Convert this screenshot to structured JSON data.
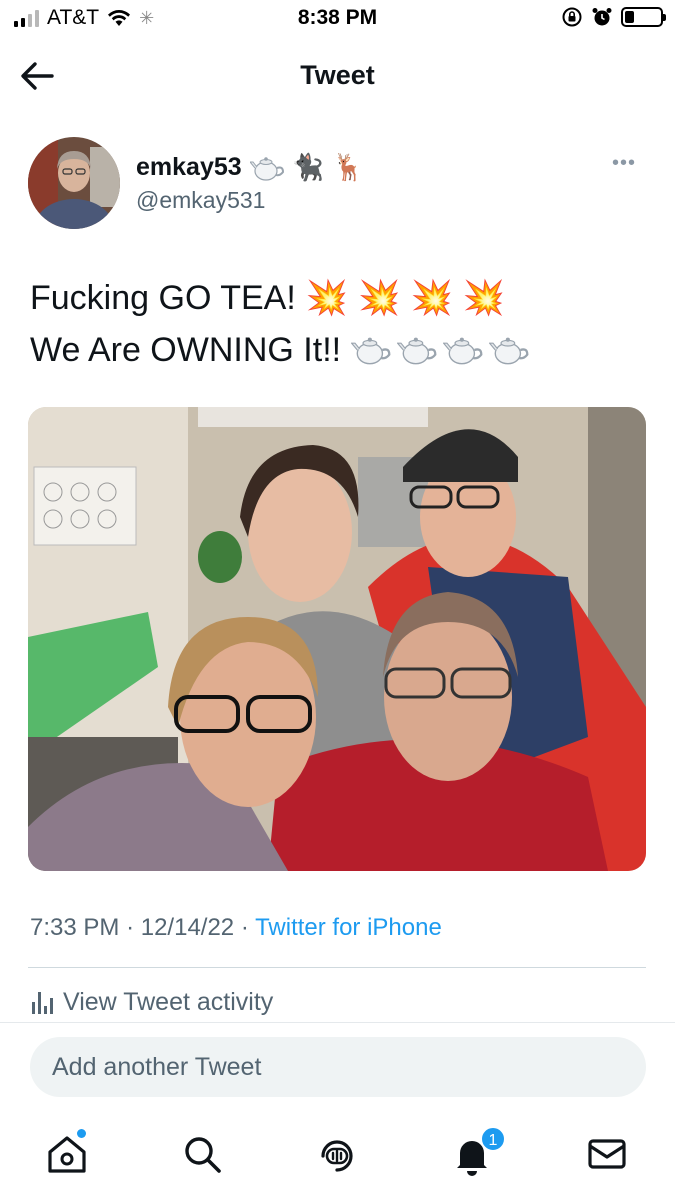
{
  "status_bar": {
    "carrier": "AT&T",
    "time": "8:38 PM",
    "signal_bars_filled": 2,
    "battery_level": 0.25
  },
  "header": {
    "title": "Tweet"
  },
  "tweet": {
    "display_name": "emkay53",
    "name_emojis": [
      "teapot",
      "🐈‍⬛",
      "🦌"
    ],
    "handle": "@emkay531",
    "text_line1": "Fucking GO TEA!",
    "text_line1_emojis": [
      "💥",
      "💥",
      "💥",
      "💥"
    ],
    "text_line2": "We Are OWNING It!!",
    "text_line2_emojis": [
      "teapot",
      "teapot",
      "teapot",
      "teapot"
    ],
    "time": "7:33 PM",
    "date": "12/14/22",
    "separator": "·",
    "source": "Twitter for iPhone",
    "activity_label": "View Tweet activity"
  },
  "reply": {
    "placeholder": "Add another Tweet"
  },
  "tab_bar": {
    "notifications_badge": "1"
  },
  "colors": {
    "accent": "#1d9bf0",
    "secondary_text": "#536471",
    "primary_text": "#0f1419"
  },
  "icons": [
    "back-arrow-icon",
    "more-icon",
    "bar-chart-icon",
    "home-icon",
    "search-icon",
    "spaces-icon",
    "bell-icon",
    "mail-icon"
  ]
}
